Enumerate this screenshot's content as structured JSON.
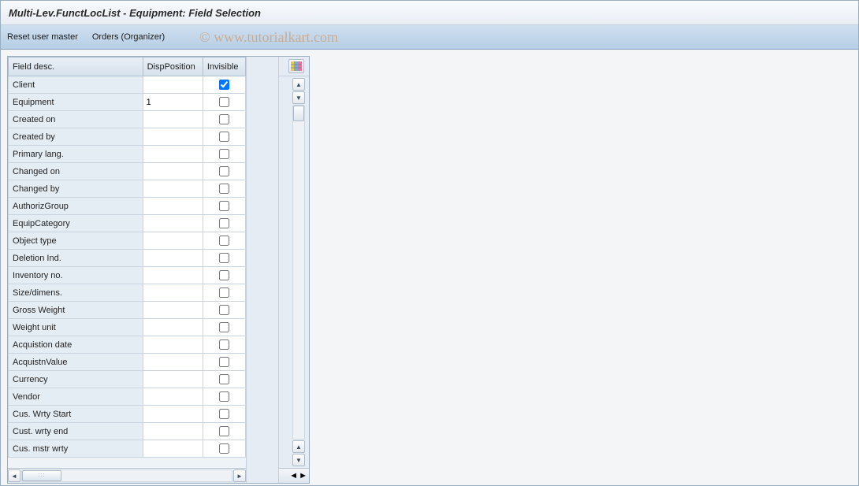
{
  "title": "Multi-Lev.FunctLocList - Equipment: Field Selection",
  "toolbar": {
    "reset_label": "Reset user master",
    "orders_label": "Orders (Organizer)"
  },
  "watermark": "© www.tutorialkart.com",
  "columns": {
    "field": "Field desc.",
    "pos": "DispPosition",
    "inv": "Invisible"
  },
  "rows": [
    {
      "field": "Client",
      "pos": "",
      "inv": true
    },
    {
      "field": "Equipment",
      "pos": "1",
      "inv": false
    },
    {
      "field": "Created on",
      "pos": "",
      "inv": false
    },
    {
      "field": "Created by",
      "pos": "",
      "inv": false
    },
    {
      "field": "Primary lang.",
      "pos": "",
      "inv": false
    },
    {
      "field": "Changed on",
      "pos": "",
      "inv": false
    },
    {
      "field": "Changed by",
      "pos": "",
      "inv": false
    },
    {
      "field": "AuthorizGroup",
      "pos": "",
      "inv": false
    },
    {
      "field": "EquipCategory",
      "pos": "",
      "inv": false
    },
    {
      "field": "Object type",
      "pos": "",
      "inv": false
    },
    {
      "field": "Deletion Ind.",
      "pos": "",
      "inv": false
    },
    {
      "field": "Inventory no.",
      "pos": "",
      "inv": false
    },
    {
      "field": "Size/dimens.",
      "pos": "",
      "inv": false
    },
    {
      "field": "Gross Weight",
      "pos": "",
      "inv": false
    },
    {
      "field": "Weight unit",
      "pos": "",
      "inv": false
    },
    {
      "field": "Acquistion date",
      "pos": "",
      "inv": false
    },
    {
      "field": "AcquistnValue",
      "pos": "",
      "inv": false
    },
    {
      "field": "Currency",
      "pos": "",
      "inv": false
    },
    {
      "field": "Vendor",
      "pos": "",
      "inv": false
    },
    {
      "field": "Cus. Wrty Start",
      "pos": "",
      "inv": false
    },
    {
      "field": "Cust. wrty end",
      "pos": "",
      "inv": false
    },
    {
      "field": "Cus. mstr wrty",
      "pos": "",
      "inv": false
    }
  ]
}
